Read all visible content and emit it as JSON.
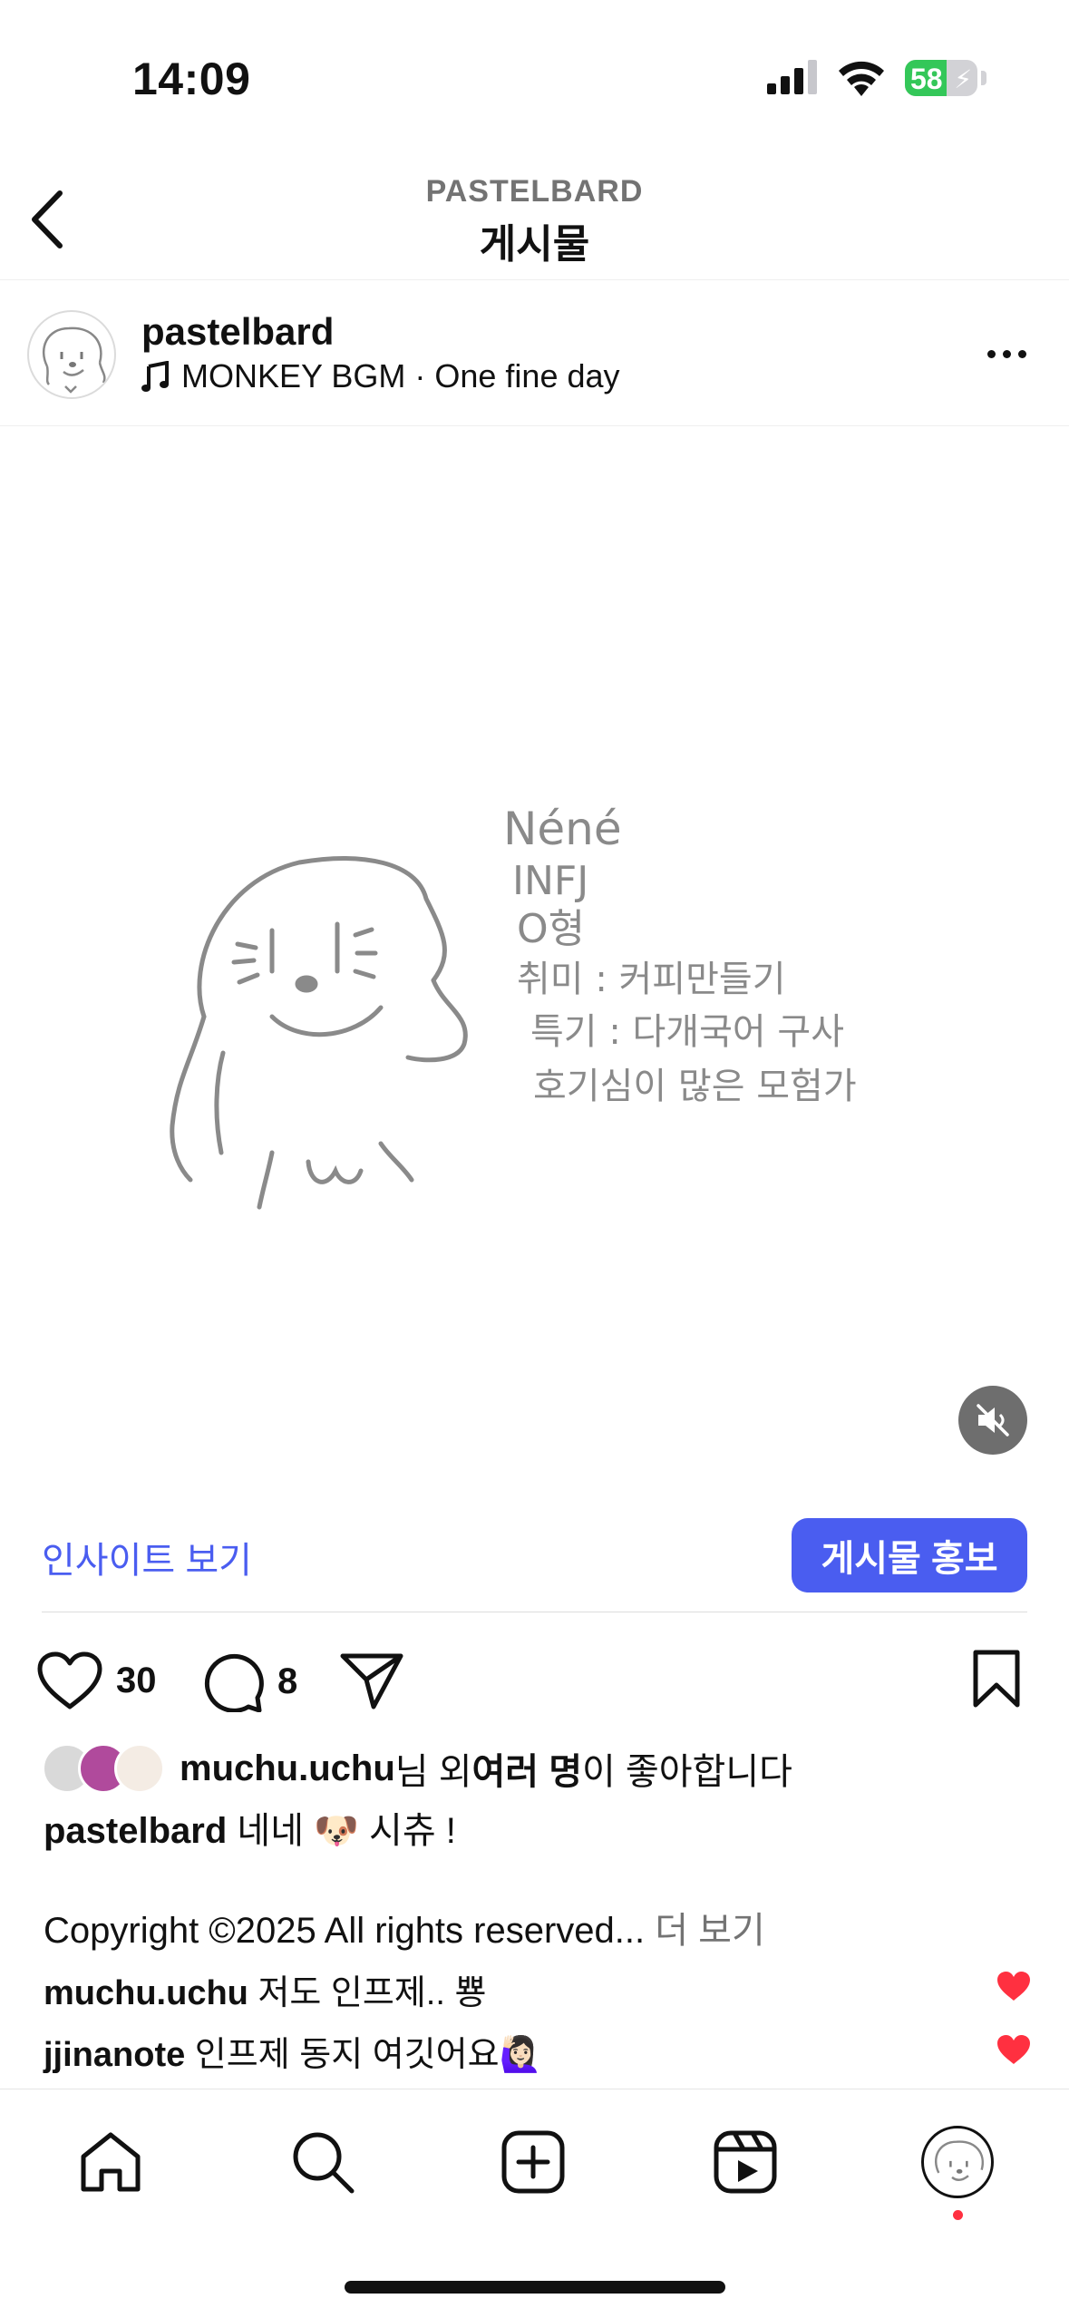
{
  "status_bar": {
    "time": "14:09",
    "battery": "58",
    "battery_level": 0.58
  },
  "header": {
    "subtitle": "PASTELBARD",
    "title": "게시물"
  },
  "post": {
    "username": "pastelbard",
    "music": "MONKEY BGM · One fine day",
    "drawing_text": [
      "Néné",
      "INFJ",
      "O형",
      "취미 : 커피만들기",
      "특기 : 다개국어 구사",
      "호기심이 많은 모험가"
    ]
  },
  "insight": {
    "link": "인사이트 보기",
    "promote": "게시물 홍보"
  },
  "actions": {
    "likes": "30",
    "comments": "8"
  },
  "likes_line": {
    "user": "muchu.uchu",
    "mid": "님 외 ",
    "many": "여러 명",
    "end": "이 좋아합니다"
  },
  "caption": {
    "user": "pastelbard",
    "text": "네네 🐶 시츄 !"
  },
  "copyright": {
    "text": "Copyright ©2025 All rights reserved... ",
    "more": "더 보기"
  },
  "comments": [
    {
      "user": "muchu.uchu",
      "text": "저도 인프제.. 뿅"
    },
    {
      "user": "jjinanote",
      "text": "인프제 동지 여깃어요🙋🏻‍♀️"
    }
  ],
  "colors": {
    "accent": "#4a5df0",
    "like_red": "#ff3040",
    "battery_green": "#34c759"
  }
}
